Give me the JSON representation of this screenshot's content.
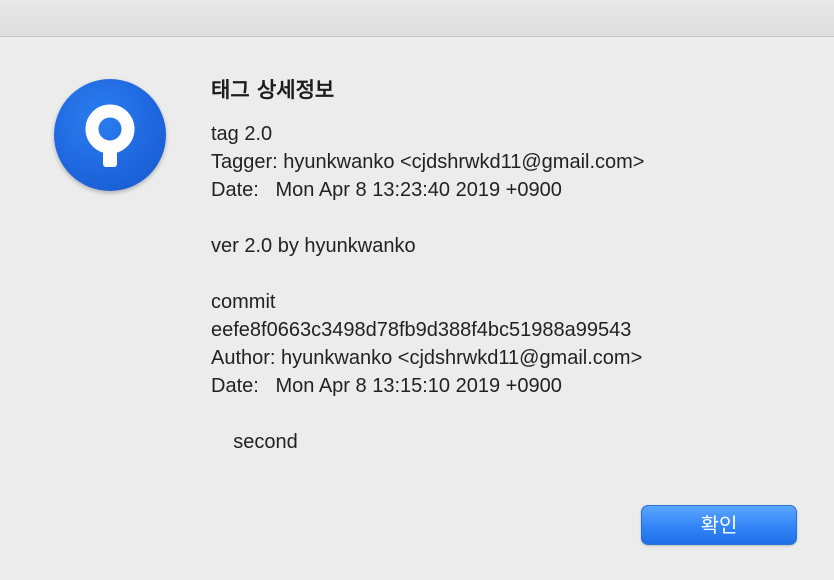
{
  "dialog": {
    "title": "태그 상세정보",
    "message_lines": [
      "tag 2.0",
      "Tagger: hyunkwanko <cjdshrwkd11@gmail.com>",
      "Date:   Mon Apr 8 13:23:40 2019 +0900",
      "",
      "ver 2.0 by hyunkwanko",
      "",
      "commit",
      "eefe8f0663c3498d78fb9d388f4bc51988a99543",
      "Author: hyunkwanko <cjdshrwkd11@gmail.com>",
      "Date:   Mon Apr 8 13:15:10 2019 +0900",
      "",
      "    second"
    ],
    "confirm_label": "확인"
  },
  "icon": {
    "name": "sourcetree-app-icon",
    "color": "#1f67df"
  }
}
